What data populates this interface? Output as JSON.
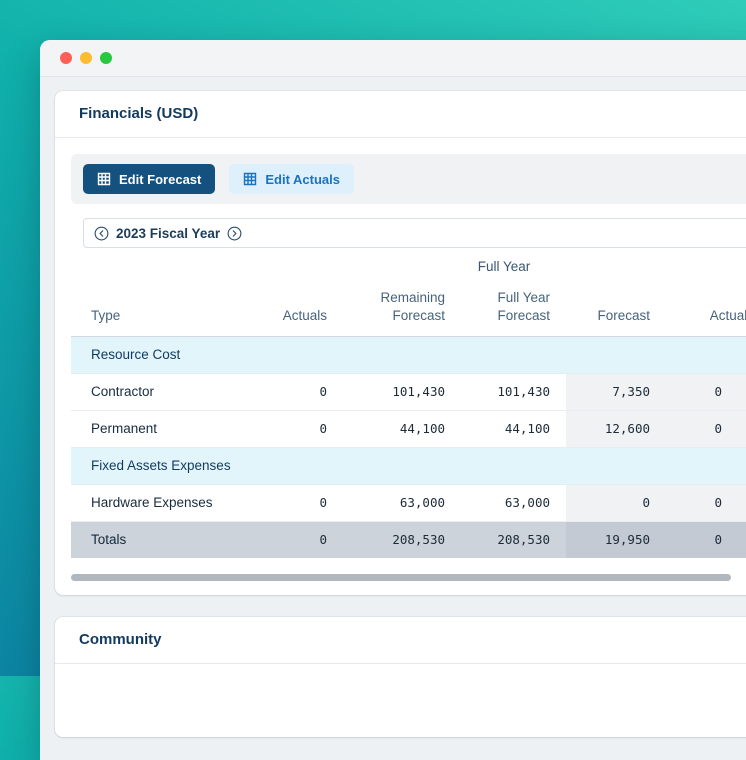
{
  "window": {
    "traffic_lights": [
      "close",
      "minimize",
      "zoom"
    ]
  },
  "financials": {
    "title": "Financials (USD)",
    "toolbar": {
      "edit_forecast": "Edit Forecast",
      "edit_actuals": "Edit Actuals"
    },
    "fiscal_year": {
      "label": "2023 Fiscal Year",
      "prev_icon": "chevron-left-circle",
      "next_icon": "chevron-right-circle"
    },
    "table": {
      "group_full_year": "Full Year",
      "headers": [
        "Type",
        "Actuals",
        "Remaining Forecast",
        "Full Year Forecast",
        "Forecast",
        "Actuals"
      ],
      "rows": [
        {
          "kind": "section",
          "label": "Resource Cost"
        },
        {
          "kind": "data",
          "label": "Contractor",
          "values": [
            "0",
            "101,430",
            "101,430",
            "7,350",
            "0"
          ]
        },
        {
          "kind": "data",
          "label": "Permanent",
          "values": [
            "0",
            "44,100",
            "44,100",
            "12,600",
            "0"
          ]
        },
        {
          "kind": "section",
          "label": "Fixed Assets Expenses"
        },
        {
          "kind": "data",
          "label": "Hardware Expenses",
          "values": [
            "0",
            "63,000",
            "63,000",
            "0",
            "0"
          ]
        },
        {
          "kind": "totals",
          "label": "Totals",
          "values": [
            "0",
            "208,530",
            "208,530",
            "19,950",
            "0"
          ]
        }
      ]
    }
  },
  "community": {
    "title": "Community"
  },
  "icons": {
    "button_icon": "table-grid"
  },
  "colors": {
    "primary_button_bg": "#15517e",
    "light_button_bg": "#def0fb",
    "light_button_text": "#1a73c0",
    "section_row_bg": "#e2f5fb",
    "totals_row_bg": "#ccd3da",
    "month_column_bg": "#f0f2f4",
    "heading_text": "#12395e",
    "traffic_red": "#ff5f57",
    "traffic_yellow": "#febc2e",
    "traffic_green": "#28c840"
  }
}
